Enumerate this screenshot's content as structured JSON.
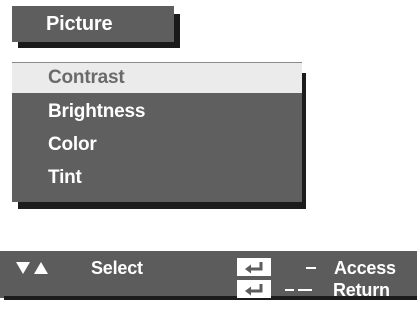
{
  "menu": {
    "title": "Picture",
    "items": [
      {
        "label": "Contrast",
        "selected": true
      },
      {
        "label": "Brightness",
        "selected": false
      },
      {
        "label": "Color",
        "selected": false
      },
      {
        "label": "Tint",
        "selected": false
      }
    ]
  },
  "help": {
    "nav_icon": "up-down-arrows-icon",
    "select_label": "Select",
    "enter_icon": "enter-key-icon",
    "access_label": "Access",
    "return_label": "Return"
  },
  "colors": {
    "panel": "#5f5f5f",
    "highlight": "#ebebeb",
    "shadow": "#1c1c1c",
    "text": "#ffffff"
  }
}
